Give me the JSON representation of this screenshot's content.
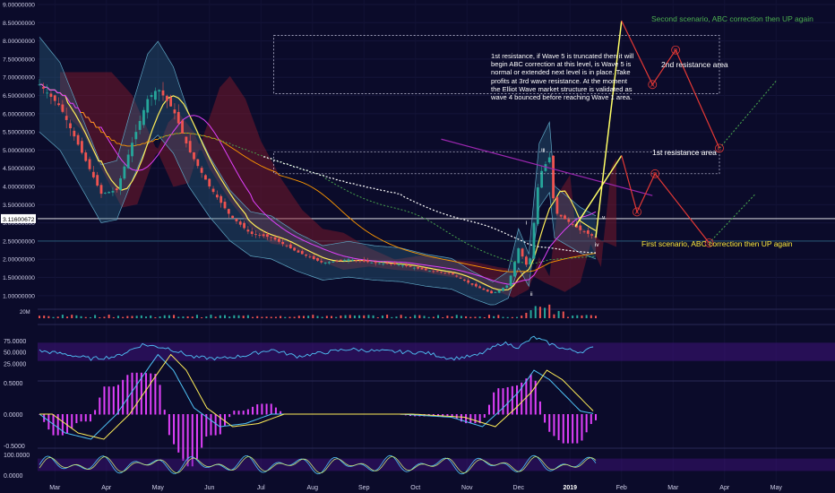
{
  "chart_data": {
    "type": "candlestick",
    "title": "",
    "price_axis": {
      "min": 0.75,
      "max": 9.0,
      "ticks": [
        "9.00000000",
        "8.50000000",
        "8.00000000",
        "7.50000000",
        "7.00000000",
        "6.50000000",
        "6.00000000",
        "5.50000000",
        "5.00000000",
        "4.50000000",
        "4.00000000",
        "3.50000000",
        "3.00000000",
        "2.50000000",
        "2.00000000",
        "1.50000000",
        "1.00000000"
      ],
      "tick_values": [
        9.0,
        8.5,
        8.0,
        7.5,
        7.0,
        6.5,
        6.0,
        5.5,
        5.0,
        4.5,
        4.0,
        3.5,
        3.0,
        2.5,
        2.0,
        1.5,
        1.0
      ],
      "current_price_label": "3.11600672",
      "current_price": 3.116
    },
    "time_axis": {
      "labels": [
        "Mar",
        "Apr",
        "May",
        "Jun",
        "Jul",
        "Aug",
        "Sep",
        "Oct",
        "Nov",
        "Dec",
        "2019",
        "Feb",
        "Mar",
        "Apr",
        "May"
      ],
      "positions_month_index": [
        0.3,
        1.3,
        2.3,
        3.3,
        4.3,
        5.3,
        6.3,
        7.3,
        8.3,
        9.3,
        10.3,
        11.3,
        12.3,
        13.3,
        14.3
      ]
    },
    "price_path": {
      "month_index": [
        0,
        0.4,
        0.8,
        1.2,
        1.5,
        1.8,
        2.1,
        2.3,
        2.6,
        2.9,
        3.3,
        3.7,
        4.1,
        4.5,
        5.0,
        5.5,
        6.0,
        6.5,
        7.0,
        7.5,
        8.0,
        8.4,
        8.8,
        9.1,
        9.3,
        9.5,
        9.7,
        9.9,
        10.0,
        10.2,
        10.5,
        10.8
      ],
      "close": [
        6.8,
        6.2,
        5.0,
        3.8,
        3.9,
        5.2,
        6.4,
        6.7,
        6.1,
        5.0,
        4.0,
        3.2,
        2.7,
        2.6,
        2.2,
        1.9,
        2.0,
        1.9,
        1.85,
        1.7,
        1.6,
        1.3,
        1.05,
        1.3,
        2.3,
        1.7,
        4.3,
        4.8,
        3.3,
        3.1,
        2.8,
        2.6
      ]
    },
    "indicators": {
      "volume_label": "20M",
      "rsi": {
        "ticks": [
          "75.0000",
          "50.0000",
          "25.0000"
        ],
        "tick_values": [
          75,
          50,
          25
        ],
        "month_index": [
          0,
          0.5,
          1,
          1.5,
          2,
          2.5,
          3,
          3.5,
          4,
          4.5,
          5,
          5.5,
          6,
          6.5,
          7,
          7.5,
          8,
          8.5,
          9,
          9.3,
          9.6,
          9.9,
          10.2,
          10.5,
          10.8
        ],
        "values": [
          52,
          45,
          35,
          40,
          66,
          58,
          38,
          35,
          42,
          55,
          40,
          48,
          56,
          52,
          50,
          48,
          35,
          42,
          70,
          60,
          82,
          68,
          56,
          50,
          60
        ]
      },
      "macd": {
        "ticks": [
          "0.5000",
          "0.0000",
          "-0.5000"
        ],
        "tick_values": [
          0.5,
          0.0,
          -0.5
        ],
        "month_index": [
          0,
          0.5,
          1,
          1.5,
          2,
          2.3,
          2.6,
          3,
          3.5,
          4,
          4.5,
          5,
          6,
          7,
          8,
          8.6,
          9,
          9.3,
          9.6,
          9.9,
          10.2,
          10.5,
          10.8
        ],
        "values": [
          0.0,
          -0.3,
          -0.4,
          0.0,
          0.6,
          0.95,
          0.7,
          0.1,
          -0.2,
          -0.15,
          0.0,
          0.0,
          0.0,
          0.0,
          -0.05,
          -0.2,
          0.1,
          0.35,
          0.7,
          0.55,
          0.3,
          0.05,
          0.0
        ]
      },
      "stoch": {
        "ticks": [
          "100.0000",
          "0.0000"
        ],
        "tick_values": [
          100,
          0
        ]
      }
    },
    "resistance_levels": [
      {
        "name": "1st resistance area",
        "price": 4.7
      },
      {
        "name": "2nd resistance area",
        "price": 7.55
      }
    ],
    "wave_labels": [
      "i",
      "ii",
      "iii",
      "iv",
      "v"
    ],
    "scenario_points": [
      "A",
      "B",
      "C",
      "A",
      "B",
      "C"
    ],
    "annotations": {
      "main_note": "1st resistance, if Wave 5 is truncated then it will begin ABC correction at this level, is Wave 5 is normal or extended next level is in place. Take profits at 3rd wave resistance. At the moment the Elliot Wave market structure is validated as wave 4 bounced before reaching Wave 1 area.",
      "second_scenario": "Second scenario, ABC correction then UP again",
      "first_scenario": "First scenario, ABC correction then UP again",
      "first_resistance": "1st resistance area",
      "second_resistance": "2nd resistance area"
    },
    "colors": {
      "background": "#0b0b2a",
      "candle_up": "#26a69a",
      "candle_down": "#ef5350",
      "scenario_up": "#ffff66",
      "scenario_down": "#e53935",
      "second_scenario_text": "#4caf50",
      "first_scenario_text": "#ffeb3b",
      "rsi": "#4fc3f7",
      "rsi_band": "#4a148c",
      "macd_line": "#4fc3f7",
      "signal_line": "#ffee58",
      "histogram": "#e040fb"
    }
  }
}
